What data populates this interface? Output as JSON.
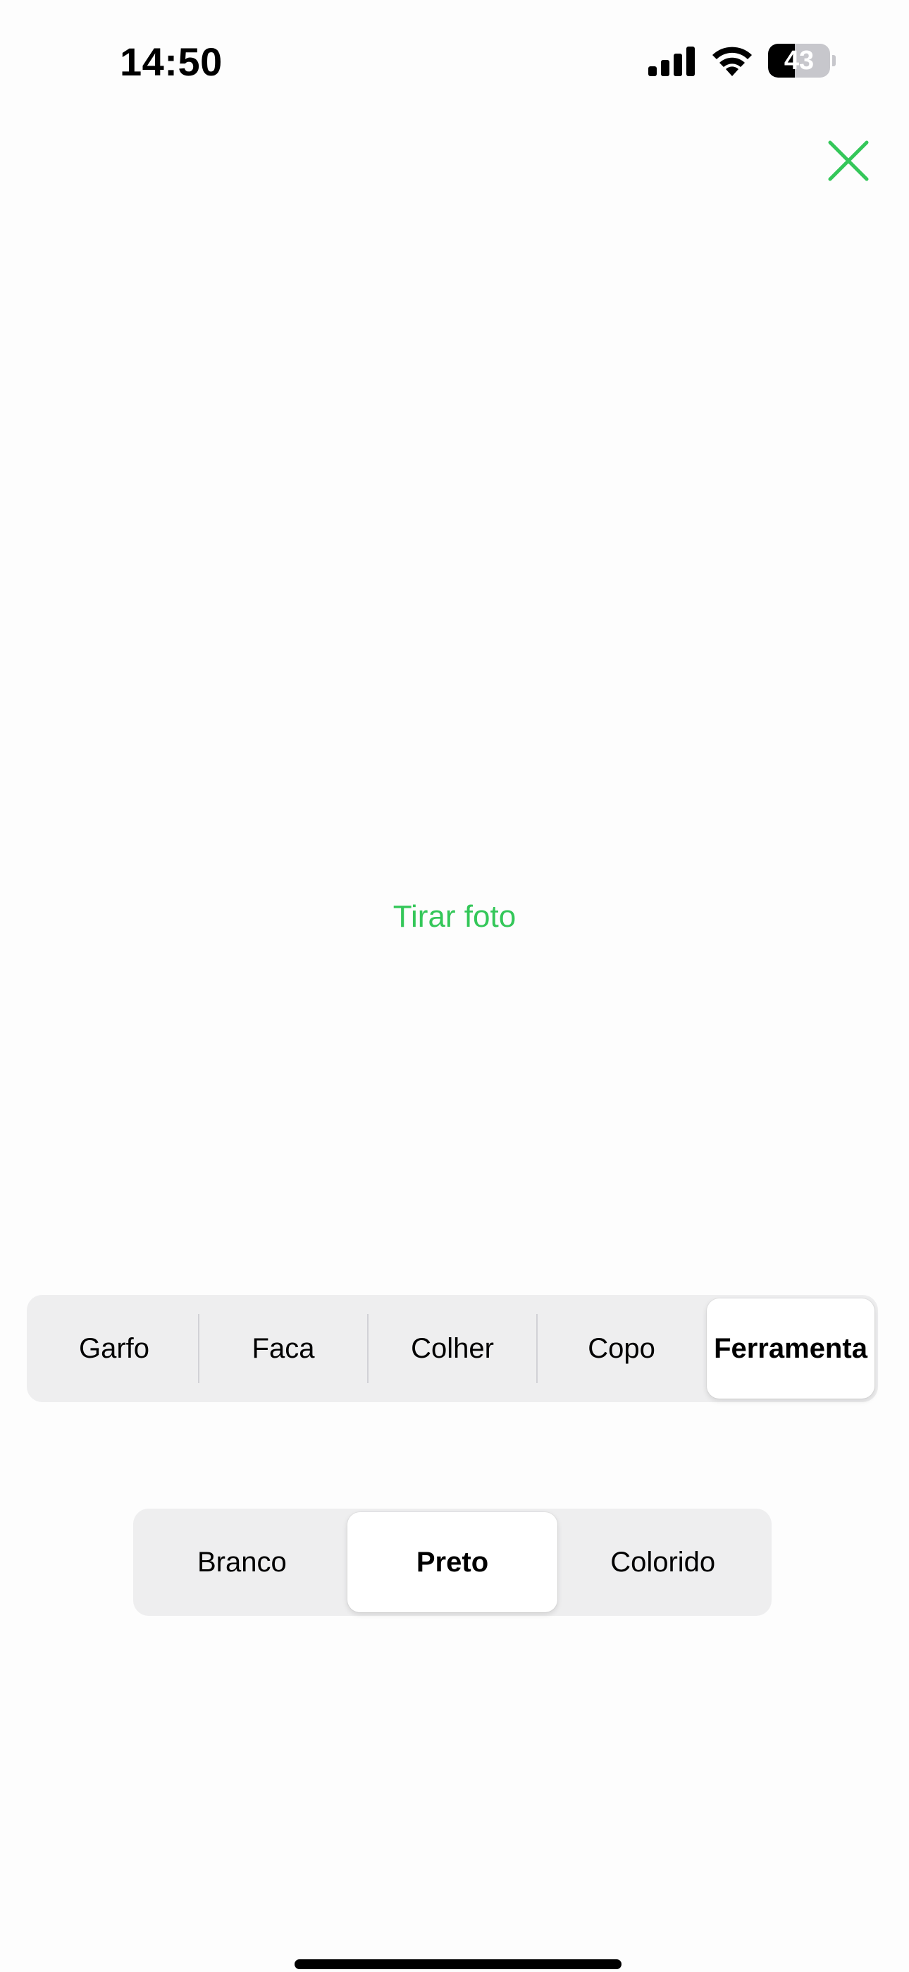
{
  "status_bar": {
    "time": "14:50",
    "battery_level": "43",
    "battery_fraction": 0.43,
    "icons": [
      "cellular-signal-icon",
      "wifi-icon",
      "battery-icon"
    ]
  },
  "close_button": {
    "icon": "close-icon",
    "color": "#34c759"
  },
  "take_photo": {
    "label": "Tirar foto",
    "color": "#34c759"
  },
  "object_selector": {
    "options": [
      {
        "label": "Garfo",
        "selected": false
      },
      {
        "label": "Faca",
        "selected": false
      },
      {
        "label": "Colher",
        "selected": false
      },
      {
        "label": "Copo",
        "selected": false
      },
      {
        "label": "Ferramenta",
        "selected": true
      }
    ]
  },
  "color_selector": {
    "options": [
      {
        "label": "Branco",
        "selected": false
      },
      {
        "label": "Preto",
        "selected": true
      },
      {
        "label": "Colorido",
        "selected": false
      }
    ]
  },
  "colors": {
    "accent": "#34c759",
    "segment_bg": "#eeeeef",
    "background": "#fdfdfd"
  }
}
